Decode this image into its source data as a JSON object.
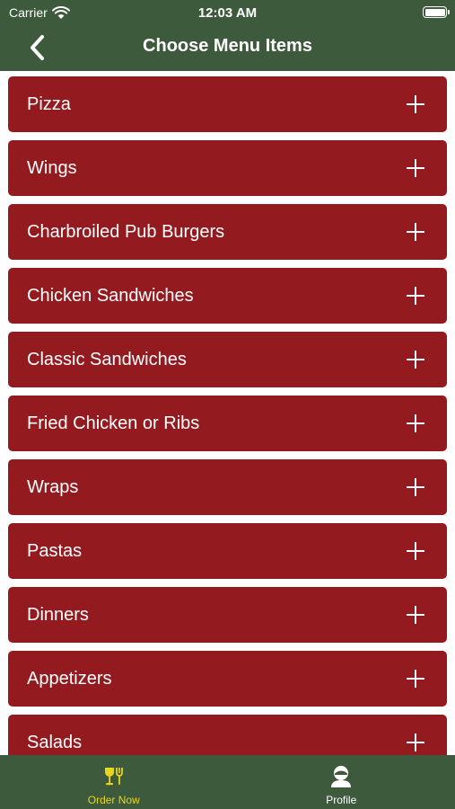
{
  "status_bar": {
    "carrier": "Carrier",
    "time": "12:03 AM"
  },
  "nav": {
    "title": "Choose Menu Items",
    "back_icon": "chevron-left-icon"
  },
  "menu_items": [
    {
      "label": "Pizza"
    },
    {
      "label": "Wings"
    },
    {
      "label": "Charbroiled Pub Burgers"
    },
    {
      "label": "Chicken Sandwiches"
    },
    {
      "label": "Classic Sandwiches"
    },
    {
      "label": "Fried Chicken or Ribs"
    },
    {
      "label": "Wraps"
    },
    {
      "label": "Pastas"
    },
    {
      "label": "Dinners"
    },
    {
      "label": "Appetizers"
    },
    {
      "label": "Salads"
    }
  ],
  "tab_bar": {
    "tabs": [
      {
        "label": "Order Now",
        "icon": "wine-glass-fork-icon",
        "active": true
      },
      {
        "label": "Profile",
        "icon": "profile-icon",
        "active": false
      }
    ]
  },
  "colors": {
    "header_bg": "#3d5a3c",
    "item_bg": "#931b20",
    "active_tab": "#e8d61a",
    "text": "#ffffff"
  }
}
